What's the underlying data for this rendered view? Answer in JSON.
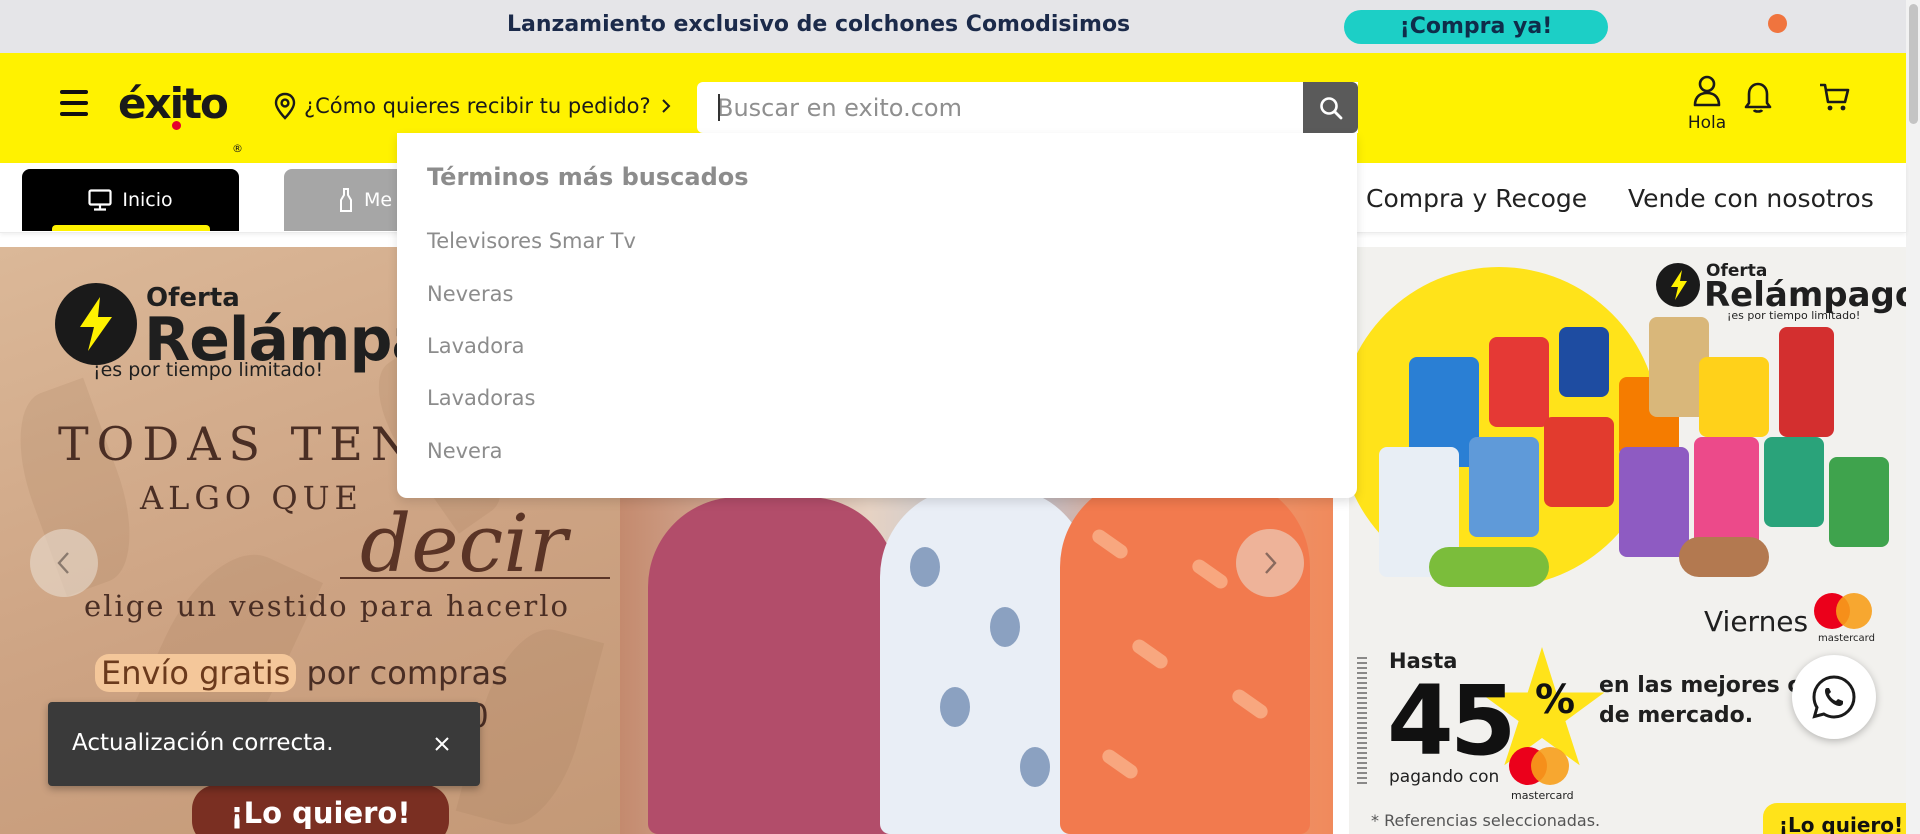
{
  "promo_bar": {
    "text": "Lanzamiento exclusivo de colchones Comodisimos",
    "cta": "¡Compra ya!"
  },
  "header": {
    "logo_text": "éxito",
    "logo_mark": "®",
    "delivery_prompt": "¿Cómo quieres recibir tu pedido?",
    "search_placeholder": "Buscar en exito.com",
    "search_value": "",
    "user_label": "Hola",
    "icons": [
      "menu-icon",
      "location-pin-icon",
      "chevron-right-icon",
      "search-icon",
      "user-icon",
      "bell-icon",
      "cart-icon"
    ]
  },
  "category_nav": {
    "tabs": [
      {
        "label": "Inicio",
        "icon": "monitor-icon",
        "active": true
      },
      {
        "label": "Me",
        "icon": "bottle-icon",
        "active": false
      }
    ],
    "links": [
      "Compra y Recoge",
      "Vende con nosotros"
    ]
  },
  "search_dropdown": {
    "title": "Términos más buscados",
    "items": [
      "Televisores Smar Tv",
      "Neveras",
      "Lavadora",
      "Lavadoras",
      "Nevera"
    ]
  },
  "main_banner": {
    "badge_small": "Oferta",
    "badge_big": "Relámpa",
    "badge_sub": "¡es por tiempo limitado!",
    "line1": "TODAS TEN",
    "line2": "ALGO QUE",
    "line3": "decir",
    "line4": "elige un vestido para hacerlo",
    "shipping_highlight": "Envío gratis",
    "shipping_rest": " por compras",
    "shipping_amount": "00",
    "cta": "¡Lo quiero!"
  },
  "side_banner": {
    "badge_small": "Oferta",
    "badge_big": "Relámpago",
    "badge_sub": "¡es por tiempo limitado!",
    "day": "Viernes",
    "card_brand": "mastercard",
    "hasta": "Hasta",
    "discount": "45",
    "percent": "%",
    "pagando": "pagando con",
    "mejores_line1": "en las mejores cate",
    "mejores_line2": "de mercado.",
    "refs": "* Referencias seleccionadas.",
    "cta": "¡Lo quiero!"
  },
  "toast": {
    "message": "Actualización correcta.",
    "close_icon": "close-icon"
  },
  "colors": {
    "header_bg": "#fff200",
    "promo_bg": "#e5e5e8",
    "promo_cta": "#1ccfc6",
    "toast_bg": "#3a3a3a",
    "search_button": "#5a5a5a"
  }
}
